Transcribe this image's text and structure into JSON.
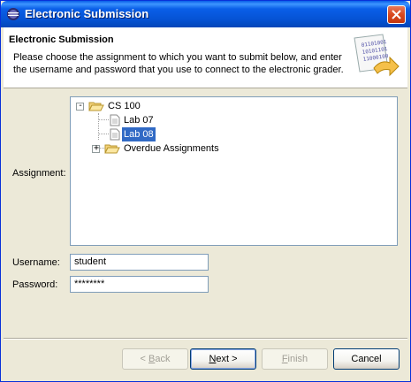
{
  "window": {
    "title": "Electronic Submission"
  },
  "banner": {
    "title": "Electronic Submission",
    "description": "Please choose the assignment to which you want to submit below, and enter the username and password that you use to connect to the electronic grader."
  },
  "form": {
    "assignment_label": "Assignment:",
    "username_label": "Username:",
    "password_label": "Password:",
    "username_value": "student",
    "password_value": "********"
  },
  "tree": {
    "root": "CS 100",
    "items": [
      "Lab 07",
      "Lab 08"
    ],
    "selected": "Lab 08",
    "overdue": "Overdue Assignments"
  },
  "buttons": {
    "back_mnemonic": "B",
    "back_rest": "ack",
    "back_prefix": "< ",
    "next_mnemonic": "N",
    "next_rest": "ext >",
    "finish_mnemonic": "F",
    "finish_rest": "inish",
    "cancel": "Cancel"
  }
}
